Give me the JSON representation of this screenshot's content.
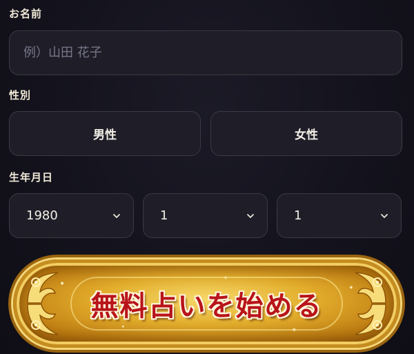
{
  "form": {
    "name_label": "お名前",
    "name_placeholder": "例）山田 花子",
    "name_value": "",
    "gender_label": "性別",
    "gender_options": [
      "男性",
      "女性"
    ],
    "birthday_label": "生年月日",
    "birth_year": "1980",
    "birth_month": "1",
    "birth_day": "1",
    "submit_label": "無料占いを始める"
  },
  "colors": {
    "background": "#13121c",
    "field_bg": "#1f1e28",
    "field_border": "#3a3946",
    "label_text": "#f1ead8",
    "placeholder_text": "#77768a",
    "cta_gold": "#e2ad2c",
    "cta_text_red": "#b8141a"
  },
  "icons": {
    "select_arrow": "chevron-down-icon",
    "cta_corner": "ornament-icon"
  }
}
